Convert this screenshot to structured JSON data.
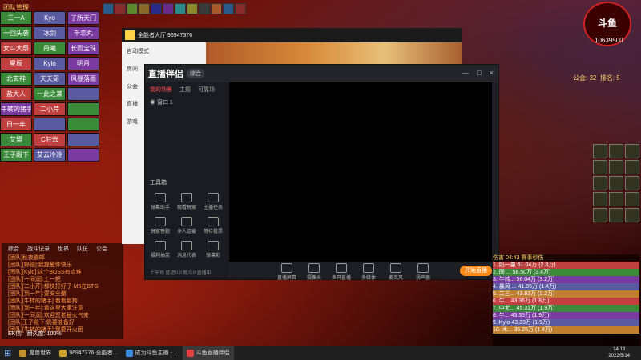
{
  "raid": {
    "title": "团队管理",
    "cells": [
      {
        "label": "三一A",
        "color": "#3a8a3a"
      },
      {
        "label": "Kyo",
        "color": "#5a5aa0"
      },
      {
        "label": "了所天门",
        "color": "#7a3aa0"
      },
      {
        "label": "一回头袭",
        "color": "#3a8a3a"
      },
      {
        "label": "冰剑",
        "color": "#5a5aa0"
      },
      {
        "label": "千恋丸",
        "color": "#7a3aa0"
      },
      {
        "label": "女斗大祭",
        "color": "#c04040"
      },
      {
        "label": "丹曦",
        "color": "#3a8a3a"
      },
      {
        "label": "长而宝珠",
        "color": "#7a3aa0"
      },
      {
        "label": "星辰",
        "color": "#c04040"
      },
      {
        "label": "Kylo",
        "color": "#5a5aa0"
      },
      {
        "label": "明月",
        "color": "#7a3aa0"
      },
      {
        "label": "北玄神",
        "color": "#3a8a3a"
      },
      {
        "label": "天天哥",
        "color": "#5a5aa0"
      },
      {
        "label": "风暴落雨",
        "color": "#7a3aa0"
      },
      {
        "label": "盐大人",
        "color": "#c04040"
      },
      {
        "label": "一此之兼",
        "color": "#3a8a3a"
      },
      {
        "label": "",
        "color": "#5a5aa0"
      },
      {
        "label": "牛转的猪手",
        "color": "#7a3aa0"
      },
      {
        "label": "二小芹",
        "color": "#c04040"
      },
      {
        "label": "",
        "color": "#3a8a3a"
      },
      {
        "label": "日一牢",
        "color": "#c04040"
      },
      {
        "label": "",
        "color": "#5a5aa0"
      },
      {
        "label": "",
        "color": "#3a8a3a"
      },
      {
        "label": "艾盟",
        "color": "#3a8a3a"
      },
      {
        "label": "C狂云",
        "color": "#c04040"
      },
      {
        "label": "",
        "color": "#5a5aa0"
      },
      {
        "label": "王子殿下",
        "color": "#3a8a3a"
      },
      {
        "label": "艾云冷冷",
        "color": "#5a5aa0"
      },
      {
        "label": "",
        "color": "#7a3aa0"
      }
    ]
  },
  "chat": {
    "tabs": [
      "综合",
      "战斗记录",
      "世界",
      "队伍",
      "公会"
    ],
    "lines": [
      "[团队]秋夜霸邮",
      "[团队][野德]:我提醒你快乐",
      "[团队][Kylo]:这个BOSS有点难",
      "[团队][一同润]:上一把",
      "[团队][二小芹]:都快打好了 M5在BTG",
      "[团队][到一年]:要安全撤",
      "[团队][牛转的猪手]:看看那狗",
      "[团队][到一年]:看这里大家注意",
      "[团队][一同润]:欢迎您老秘火气来",
      "[团队]王子殿下:奶要准备好",
      "[团队][牛转的猪手]:我要开火团"
    ],
    "input_name": "EK信l",
    "durability": "耐久度: 100%"
  },
  "browser": {
    "title": "全能者大厅 96947376",
    "side_labels": [
      "自动模式",
      "房间",
      "公会",
      "直播",
      "游戏"
    ]
  },
  "app": {
    "logo": "直播伴侣",
    "badge": "综合",
    "win_buttons": [
      "—",
      "□",
      "×"
    ],
    "scene_tabs": [
      "我的场景",
      "主题",
      "可靠场"
    ],
    "scene_item": "窗口 1",
    "tools_label": "工具箱",
    "tools": [
      "弹幕助手",
      "观看玩家",
      "主播任务",
      "玩家答题",
      "多人连麦",
      "等待投票",
      "福利抽奖",
      "消息代表",
      "弹幕彩"
    ],
    "bottom_tools": [
      "直播屏幕",
      "摄像头",
      "多开直播",
      "多媒体",
      "麦克风",
      "扬声器"
    ],
    "start_button": "开始直播",
    "status": "上午场 延迟0.0 观众0 直播中"
  },
  "hud": {
    "stream_id": "10639500",
    "brand": "斗鱼",
    "score_label": "公会:",
    "score_value": "32",
    "rank_label": "排名:",
    "rank_value": "5"
  },
  "damage": {
    "header": "伤害 04:43 赛事秒伤",
    "rows": [
      "1. 奶一量 61.04万 (2.8万)",
      "2. 同 ... 58.50万 (3.4万)",
      "3. 牛转... 56.04万 (3.2万)",
      "4. 暴风 ... 41.05万 (1.4万)",
      "5. 二三... 43.92万 (2.2万)",
      "6. 牛... 43.36万 (1.8万)",
      "7. 中尤... 45.31万 (1.9万)",
      "8. 牛... 43.35万 (1.9万)",
      "9. Kylo 43.23万 (1.9万)",
      "10. 木... 35.25万 (1.4万)"
    ]
  },
  "taskbar": {
    "items": [
      {
        "label": "魔兽世界",
        "color": "#c09030"
      },
      {
        "label": "96947376-全能者...",
        "color": "#d0a030"
      },
      {
        "label": "成为斗鱼主播 - ...",
        "color": "#3a8ae0"
      },
      {
        "label": "斗鱼直播伴侣",
        "color": "#e04040"
      }
    ],
    "time": "14:13",
    "date": "2022/5/14"
  }
}
